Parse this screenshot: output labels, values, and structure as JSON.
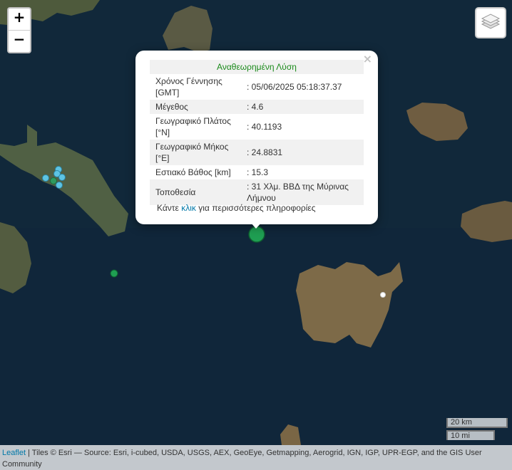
{
  "controls": {
    "zoom_in": "+",
    "zoom_out": "−"
  },
  "icons": {
    "layers": "layers-icon",
    "close": "close-icon"
  },
  "colors": {
    "sea": "#0f2436",
    "land": "#7f6b49",
    "event_main": "#1f9e52",
    "event_cluster": "#5ec4e3",
    "heading": "#1a8a1a",
    "link": "#0078a8"
  },
  "popup": {
    "close": "×",
    "heading": "Αναθεωρημένη Λύση",
    "rows": [
      {
        "label": "Χρόνος Γέννησης [GMT]",
        "value": ": 05/06/2025 05:18:37.37"
      },
      {
        "label": "Μέγεθος",
        "value": ": 4.6"
      },
      {
        "label": "Γεωγραφικό Πλάτος [°N]",
        "value": ": 40.1193"
      },
      {
        "label": "Γεωγραφικό Μήκος [°E]",
        "value": ": 24.8831"
      },
      {
        "label": "Εστιακό Βάθος [km]",
        "value": ": 15.3"
      },
      {
        "label": "Τοποθεσία",
        "value": ": 31 Χλμ. ΒΒΔ της Μύρινας Λήμνου"
      }
    ],
    "more_prefix": "Κάντε",
    "more_link": "κλικ",
    "more_suffix": "για περισσότερες πληροφορίες"
  },
  "scale": {
    "km": "20 km",
    "mi": "10 mi"
  },
  "attribution": {
    "leaflet": "Leaflet",
    "text": "| Tiles © Esri — Source: Esri, i-cubed, USDA, USGS, AEX, GeoEye, Getmapping, Aerogrid, IGN, IGP, UPR-EGP, and the GIS User Community"
  }
}
